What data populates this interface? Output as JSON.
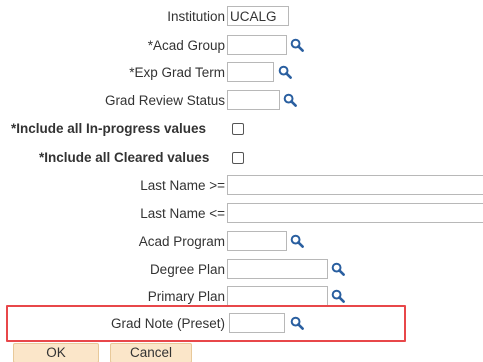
{
  "form": {
    "institution": {
      "label": "Institution",
      "value": "UCALG"
    },
    "acad_group": {
      "label": "*Acad Group",
      "value": ""
    },
    "exp_grad_term": {
      "label": "*Exp Grad Term",
      "value": ""
    },
    "grad_review_status": {
      "label": "Grad Review Status",
      "value": ""
    },
    "include_in_progress": {
      "label": "*Include all In-progress values",
      "checked": false
    },
    "include_cleared": {
      "label": "*Include all Cleared values",
      "checked": false
    },
    "last_name_ge": {
      "label": "Last Name >=",
      "value": ""
    },
    "last_name_le": {
      "label": "Last Name <=",
      "value": ""
    },
    "acad_program": {
      "label": "Acad Program",
      "value": ""
    },
    "degree_plan": {
      "label": "Degree Plan",
      "value": ""
    },
    "primary_plan": {
      "label": "Primary Plan",
      "value": ""
    },
    "grad_note": {
      "label": "Grad Note (Preset)",
      "value": ""
    }
  },
  "buttons": {
    "ok": "OK",
    "cancel": "Cancel"
  },
  "icons": {
    "lookup": "magnifier-lookup-icon"
  },
  "colors": {
    "lookup_icon": "#2a5fa0",
    "button_bg": "#fbe6c9",
    "highlight_border": "#e8474a"
  }
}
